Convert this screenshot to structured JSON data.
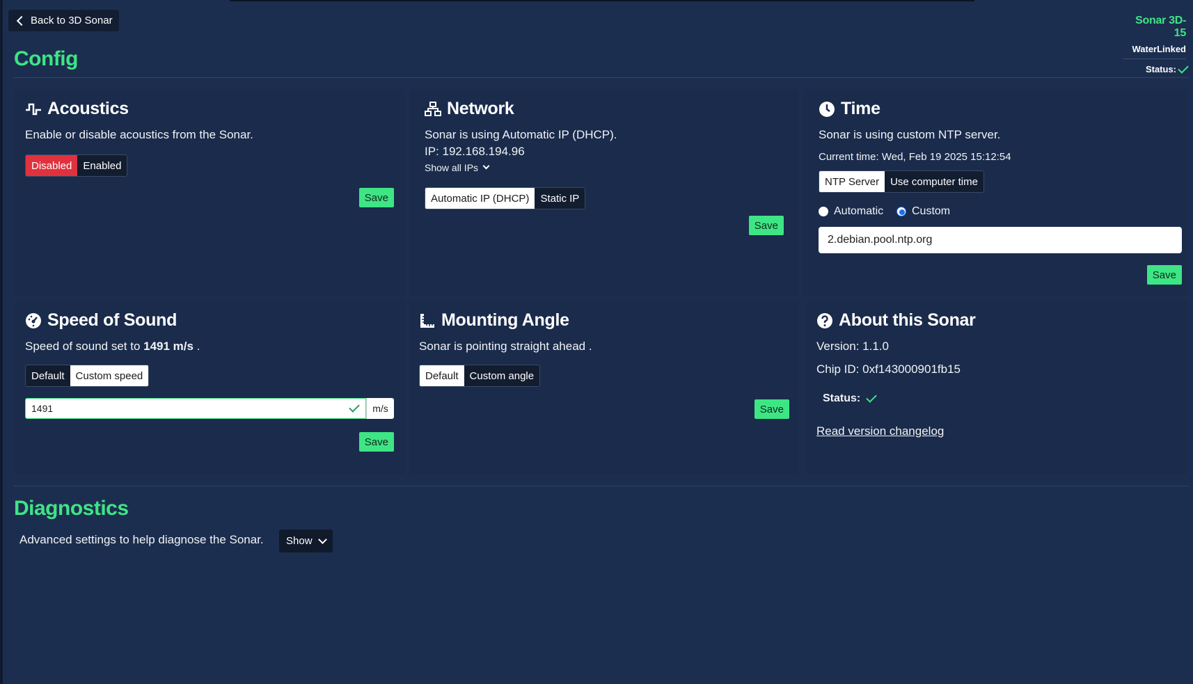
{
  "nav": {
    "back_label": "Back to 3D Sonar"
  },
  "brand": {
    "model": "Sonar 3D-15",
    "logo_text": "WaterLinked",
    "status_label": "Status:"
  },
  "config": {
    "title": "Config",
    "acoustics": {
      "title": "Acoustics",
      "description": "Enable or disable acoustics from the Sonar.",
      "options": [
        "Disabled",
        "Enabled"
      ],
      "selected": "Disabled",
      "save_label": "Save"
    },
    "network": {
      "title": "Network",
      "description": "Sonar is using Automatic IP (DHCP).",
      "ip_line": "IP: 192.168.194.96",
      "show_all_ips": "Show all IPs",
      "options": [
        "Automatic IP (DHCP)",
        "Static IP"
      ],
      "selected": "Automatic IP (DHCP)",
      "save_label": "Save"
    },
    "time": {
      "title": "Time",
      "description": "Sonar is using custom NTP server.",
      "current_time": "Current time: Wed, Feb 19 2025 15:12:54",
      "options": [
        "NTP Server",
        "Use computer time"
      ],
      "selected": "NTP Server",
      "radio_automatic": "Automatic",
      "radio_custom": "Custom",
      "radio_selected": "Custom",
      "ntp_server_value": "2.debian.pool.ntp.org",
      "save_label": "Save"
    },
    "speed_of_sound": {
      "title": "Speed of Sound",
      "description_prefix": "Speed of sound set to",
      "speed_value": "1491 m/s",
      "description_suffix": ".",
      "options": [
        "Default",
        "Custom speed"
      ],
      "selected": "Custom speed",
      "input_value": "1491",
      "unit": "m/s",
      "save_label": "Save"
    },
    "mounting_angle": {
      "title": "Mounting Angle",
      "description": "Sonar is pointing straight ahead .",
      "options": [
        "Default",
        "Custom angle"
      ],
      "selected": "Default",
      "save_label": "Save"
    },
    "about": {
      "title": "About this Sonar",
      "version": "Version: 1.1.0",
      "chip_id": "Chip ID: 0xf143000901fb15",
      "status_label": "Status:",
      "changelog_link": "Read version changelog"
    }
  },
  "diagnostics": {
    "title": "Diagnostics",
    "description": "Advanced settings to help diagnose the Sonar.",
    "show_label": "Show"
  },
  "colors": {
    "accent": "#3ee584",
    "background": "#1c2e4f",
    "card": "#1a2b4b",
    "danger": "#e0323e"
  }
}
